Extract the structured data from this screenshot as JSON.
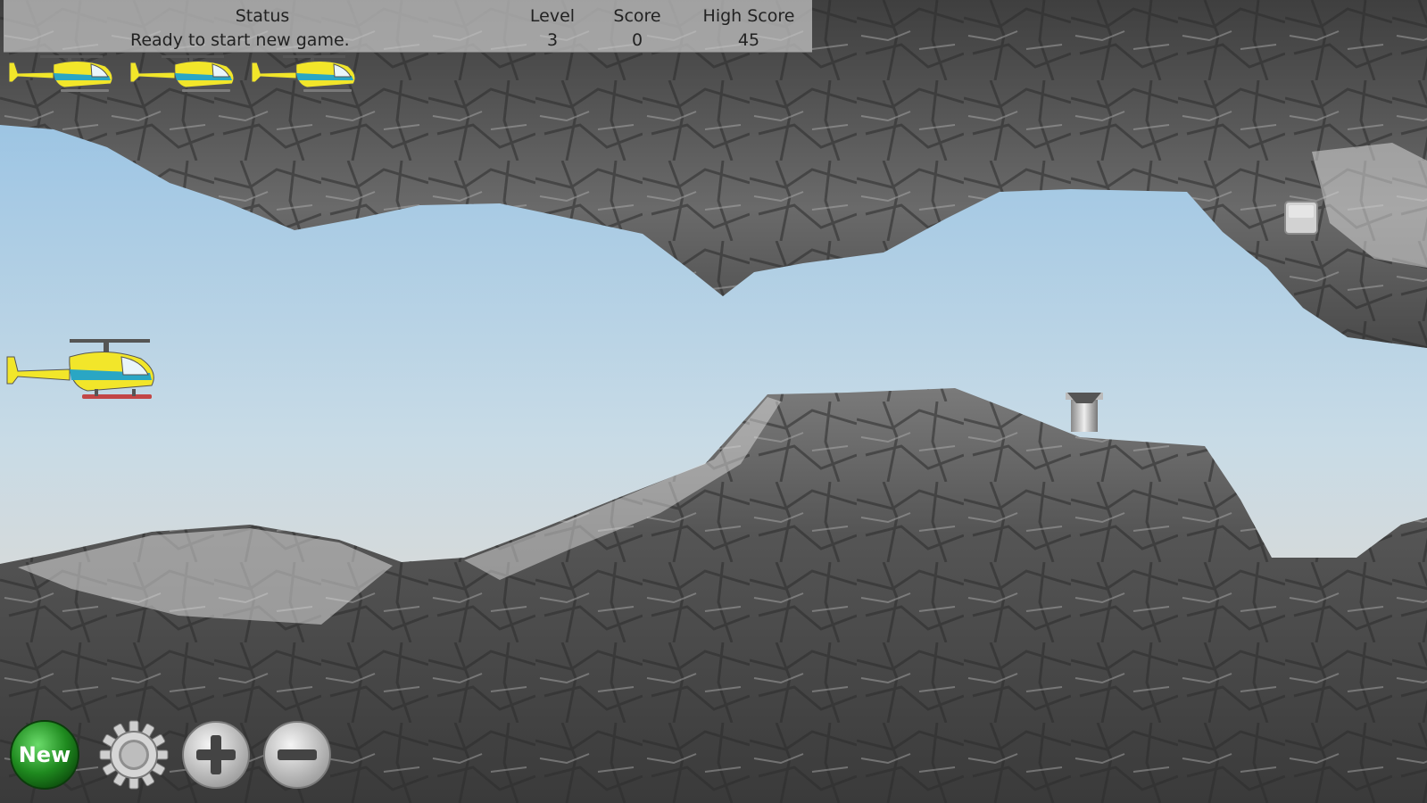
{
  "hud": {
    "status_label": "Status",
    "status_value": "Ready to start new game.",
    "level_label": "Level",
    "level_value": "3",
    "score_label": "Score",
    "score_value": "0",
    "high_score_label": "High Score",
    "high_score_value": "45"
  },
  "lives_remaining": 3,
  "controls": {
    "new_label": "New",
    "gear_icon": "gear-icon",
    "plus_icon": "plus-icon",
    "minus_icon": "minus-icon"
  },
  "colors": {
    "sky_top": "#9cc5e6",
    "sky_bottom": "#e8d6c6",
    "rock": "#5a5a5a",
    "helicopter_body": "#f2e62a",
    "helicopter_stripe": "#2aa6c4",
    "new_button": "#1f8a1f"
  }
}
